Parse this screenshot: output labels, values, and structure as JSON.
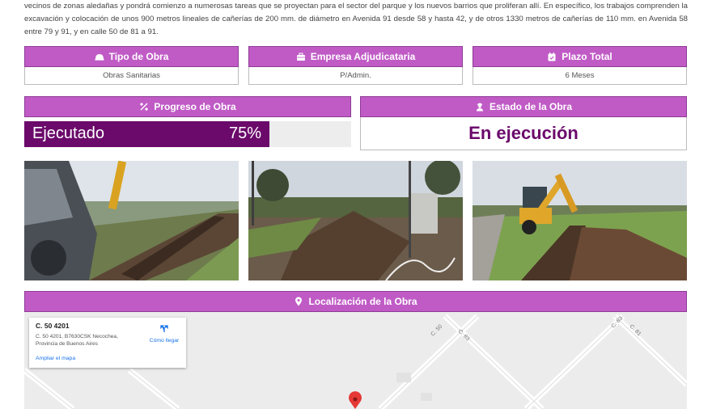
{
  "intro": {
    "text": "vecinos de zonas aledañas y pondrá comienzo a numerosas tareas que se proyectan para el sector del parque y los nuevos barrios que proliferan allí. En específico, los trabajos comprenden la excavación y colocación de unos 900 metros lineales de cañerías de 200 mm. de diámetro en Avenida 91 desde 58 y hasta 42, y de otros 1330 metros de cañerías de 110 mm. en Avenida 58 entre 79 y 91, y en calle 50 de 81 a 91."
  },
  "cards": {
    "tipo": {
      "label": "Tipo de Obra",
      "value": "Obras Sanitarias",
      "icon": "helmet-icon"
    },
    "empresa": {
      "label": "Empresa Adjudicataria",
      "value": "P/Admin.",
      "icon": "briefcase-icon"
    },
    "plazo": {
      "label": "Plazo Total",
      "value": "6 Meses",
      "icon": "calendar-icon"
    }
  },
  "progress": {
    "label": "Progreso de Obra",
    "bar_label": "Ejecutado",
    "percent_text": "75%",
    "percent": 75,
    "icon": "percent-icon"
  },
  "estado": {
    "label": "Estado de la Obra",
    "value": "En ejecución",
    "icon": "worker-icon"
  },
  "photos": [
    {
      "name": "excavator-trench-photo"
    },
    {
      "name": "site-pipes-photo"
    },
    {
      "name": "backhoe-trench-photo"
    }
  ],
  "location": {
    "label": "Localización de la Obra",
    "icon": "map-pin-icon",
    "map": {
      "place_title": "C. 50 4201",
      "address": "C. 50 4201, B7630CSK Necochea, Provincia de Buenos Aires",
      "directions_label": "Cómo llegar",
      "enlarge_label": "Ampliar el mapa",
      "street_labels": [
        "C. 50",
        "C. 83",
        "C. 83",
        "C. 81"
      ]
    }
  },
  "colors": {
    "accent": "#c05bc6",
    "accent_dark": "#6b0a6b",
    "border": "#8e3a96"
  }
}
